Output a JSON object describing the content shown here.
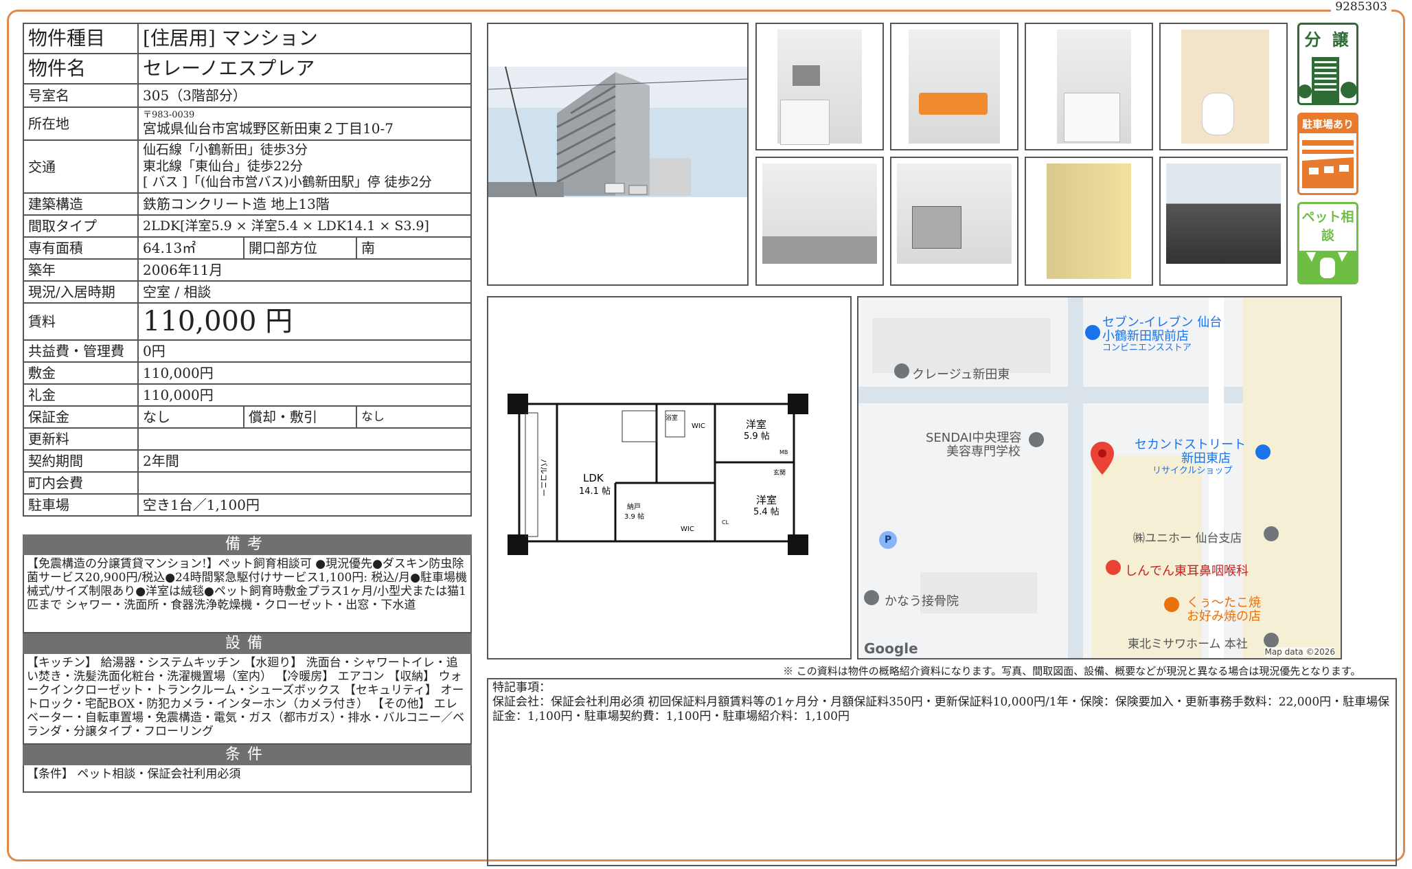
{
  "doc_id": "9285303",
  "spec": {
    "type_label": "物件種目",
    "type_value": "[住居用] マンション",
    "name_label": "物件名",
    "name_value": "セレーノエスプレア",
    "room_label": "号室名",
    "room_value": "305（3階部分）",
    "address_label": "所在地",
    "postal": "〒983-0039",
    "address": "宮城県仙台市宮城野区新田東２丁目10-7",
    "transport_label": "交通",
    "transport": [
      "仙石線「小鶴新田」徒歩3分",
      "東北線「東仙台」徒歩22分",
      "[ バス ]「(仙台市営バス)小鶴新田駅」停 徒歩2分"
    ],
    "structure_label": "建築構造",
    "structure_value": "鉄筋コンクリート造 地上13階",
    "layout_label": "間取タイプ",
    "layout_value": "2LDK[洋室5.9 × 洋室5.4 × LDK14.1 × S3.9]",
    "area_label": "専有面積",
    "area_value": "64.13㎡",
    "direction_label": "開口部方位",
    "direction_value": "南",
    "built_label": "築年",
    "built_value": "2006年11月",
    "status_label": "現況/入居時期",
    "status_value": "空室 / 相談",
    "rent_label": "賃料",
    "rent_value": "110,000 円",
    "fee_label": "共益費・管理費",
    "fee_value": "0円",
    "deposit_label": "敷金",
    "deposit_value": "110,000円",
    "keymoney_label": "礼金",
    "keymoney_value": "110,000円",
    "guarantee_label": "保証金",
    "guarantee_value": "なし",
    "amort_label": "償却・敷引",
    "amort_value": "なし",
    "renewal_label": "更新料",
    "renewal_value": "",
    "term_label": "契約期間",
    "term_value": "2年間",
    "town_label": "町内会費",
    "town_value": "",
    "parking_label": "駐車場",
    "parking_value": "空き1台／1,100円"
  },
  "remarks": {
    "title": "備考",
    "text": "【免震構造の分譲賃貸マンション!】ペット飼育相談可 ●現況優先●ダスキン防虫除菌サービス20,900円/税込●24時間緊急駆付けサービス1,100円: 税込/月●駐車場機械式/サイズ制限あり●洋室は絨毯●ペット飼育時敷金プラス1ヶ月/小型犬または猫1匹まで シャワー・洗面所・食器洗浄乾燥機・クローゼット・出窓・下水道"
  },
  "equipment": {
    "title": "設備",
    "text": "【キッチン】 給湯器・システムキッチン 【水廻り】 洗面台・シャワートイレ・追い焚き・洗髪洗面化粧台・洗濯機置場（室内） 【冷暖房】 エアコン 【収納】 ウォークインクローゼット・トランクルーム・シューズボックス 【セキュリティ】 オートロック・宅配BOX・防犯カメラ・インターホン（カメラ付き） 【その他】 エレベーター・自転車置場・免震構造・電気・ガス（都市ガス）・排水・バルコニー／ベランダ・分譲タイプ・フローリング"
  },
  "conditions": {
    "title": "条件",
    "text": "【条件】 ペット相談・保証会社利用必須"
  },
  "badges": {
    "sale": "分 譲",
    "parking": "駐車場あり",
    "pet": "ペット相談"
  },
  "floorplan": {
    "ldk": "LDK",
    "ldk_size": "14.1 帖",
    "room1": "洋室",
    "room1_size": "5.9 帖",
    "room2": "洋室",
    "room2_size": "5.4 帖",
    "storage": "納戸",
    "storage_size": "3.9 帖",
    "balcony": "バルコニー",
    "wic": "WIC",
    "bath": "浴室",
    "entrance": "玄関",
    "mb": "MB",
    "cl": "CL"
  },
  "map": {
    "seven_name": "セブン-イレブン 仙台",
    "seven_name2": "小鶴新田駅前店",
    "seven_cat": "コンビニエンスストア",
    "crage": "クレージュ新田東",
    "school1": "SENDAI中央理容",
    "school2": "美容専門学校",
    "second1": "セカンドストリート",
    "second2": "新田東店",
    "second_cat": "リサイクルショップ",
    "unihoo": "㈱ユニホー 仙台支店",
    "clinic": "しんでん東耳鼻咽喉科",
    "kanau": "かなう接骨院",
    "takoyaki1": "くぅ～たこ焼",
    "takoyaki2": "お好み焼の店",
    "misawa": "東北ミサワホーム 本社",
    "google": "Google",
    "mapdata": "Map data ©2026",
    "parking_p": "P"
  },
  "note": "※ この資料は物件の概略紹介資料になります。写真、間取図面、設備、概要などが現況と異なる場合は現況優先となります。",
  "special": {
    "title": "特記事項：",
    "text": "保証会社：保証会社利用必須 初回保証料月額賃料等の1ヶ月分・月額保証料350円・更新保証料10,000円/1年・保険：保険要加入・更新事務手数料：22,000円・駐車場保証金：1,100円・駐車場契約費：1,100円・駐車場紹介料：1,100円"
  }
}
